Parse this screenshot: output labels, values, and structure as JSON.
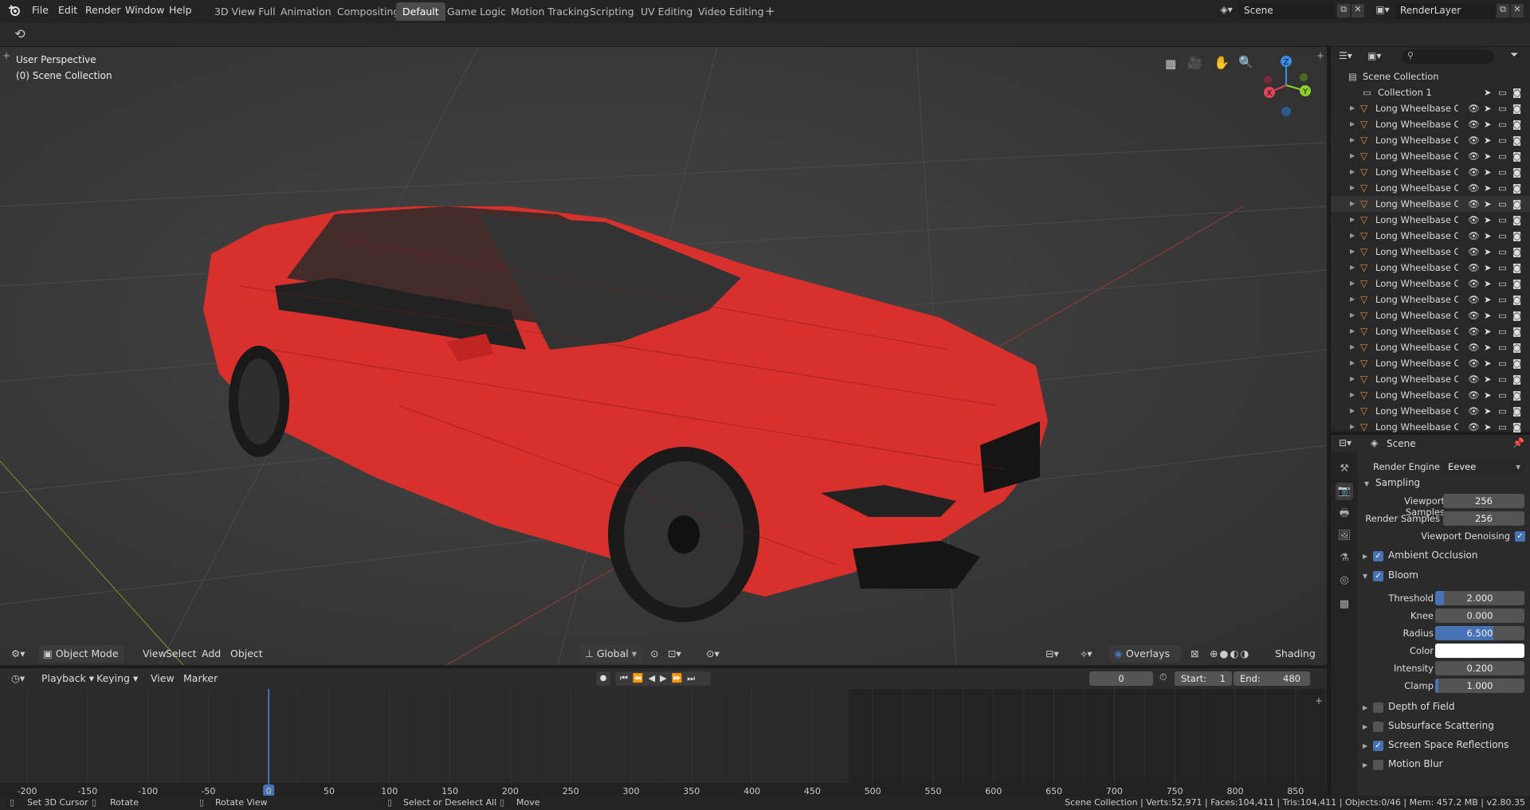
{
  "topbar": {
    "menus": [
      "File",
      "Edit",
      "Render",
      "Window",
      "Help"
    ],
    "workspaces": [
      "3D View Full",
      "Animation",
      "Compositing",
      "Default",
      "Game Logic",
      "Motion Tracking",
      "Scripting",
      "UV Editing",
      "Video Editing"
    ],
    "active_workspace": "Default",
    "add_tab": "+",
    "scene_name": "Scene",
    "render_layer": "RenderLayer"
  },
  "viewport": {
    "perspective": "User Perspective",
    "collection": "(0) Scene Collection",
    "gizmo": {
      "x": "X",
      "y": "Y",
      "z": "Z"
    },
    "header": {
      "mode": "Object Mode",
      "view": "View",
      "select": "Select",
      "add": "Add",
      "object": "Object",
      "orientation": "Global",
      "overlays": "Overlays",
      "shading": "Shading"
    }
  },
  "timeline": {
    "playback": "Playback",
    "keying": "Keying",
    "view": "View",
    "marker": "Marker",
    "current_frame": "0",
    "start_label": "Start:",
    "start": "1",
    "end_label": "End:",
    "end": "480",
    "ticks": [
      "-200",
      "-150",
      "-100",
      "-50",
      "0",
      "50",
      "100",
      "150",
      "200",
      "250",
      "300",
      "350",
      "400",
      "450",
      "500",
      "550",
      "600",
      "650",
      "700",
      "750",
      "800",
      "850"
    ],
    "current_tick": "0"
  },
  "outliner": {
    "root": "Scene Collection",
    "collection": "Collection 1",
    "items": [
      "Long Wheelbase Car",
      "Long Wheelbase Car",
      "Long Wheelbase Car",
      "Long Wheelbase Car",
      "Long Wheelbase Car",
      "Long Wheelbase Car",
      "Long Wheelbase Car",
      "Long Wheelbase Car",
      "Long Wheelbase Car",
      "Long Wheelbase Car",
      "Long Wheelbase Car",
      "Long Wheelbase Car",
      "Long Wheelbase Car",
      "Long Wheelbase Car",
      "Long Wheelbase Car",
      "Long Wheelbase Car",
      "Long Wheelbase Car",
      "Long Wheelbase Car",
      "Long Wheelbase Car",
      "Long Wheelbase Car",
      "Long Wheelbase Car"
    ],
    "selected_index": 6
  },
  "properties": {
    "context": "Scene",
    "render_engine_label": "Render Engine",
    "render_engine": "Eevee",
    "sampling": "Sampling",
    "viewport_samples_label": "Viewport Samples",
    "viewport_samples": "256",
    "render_samples_label": "Render Samples",
    "render_samples": "256",
    "viewport_denoising": "Viewport Denoising",
    "ambient_occlusion": "Ambient Occlusion",
    "bloom": "Bloom",
    "threshold_label": "Threshold",
    "threshold": "2.000",
    "knee_label": "Knee",
    "knee": "0.000",
    "radius_label": "Radius",
    "radius": "6.500",
    "color_label": "Color",
    "intensity_label": "Intensity",
    "intensity": "0.200",
    "clamp_label": "Clamp",
    "clamp": "1.000",
    "depth_of_field": "Depth of Field",
    "subsurface_scattering": "Subsurface Scattering",
    "screen_space_reflections": "Screen Space Reflections",
    "motion_blur": "Motion Blur"
  },
  "statusbar": {
    "set_cursor": "Set 3D Cursor",
    "rotate": "Rotate",
    "rotate_view": "Rotate View",
    "select_deselect": "Select or Deselect All",
    "move": "Move",
    "stats": "Scene Collection | Verts:52,971 | Faces:104,411 | Tris:104,411 | Objects:0/46 | Mem: 457.2 MB | v2.80.35"
  },
  "colors": {
    "accent": "#4772b3",
    "car": "#d8302c"
  }
}
